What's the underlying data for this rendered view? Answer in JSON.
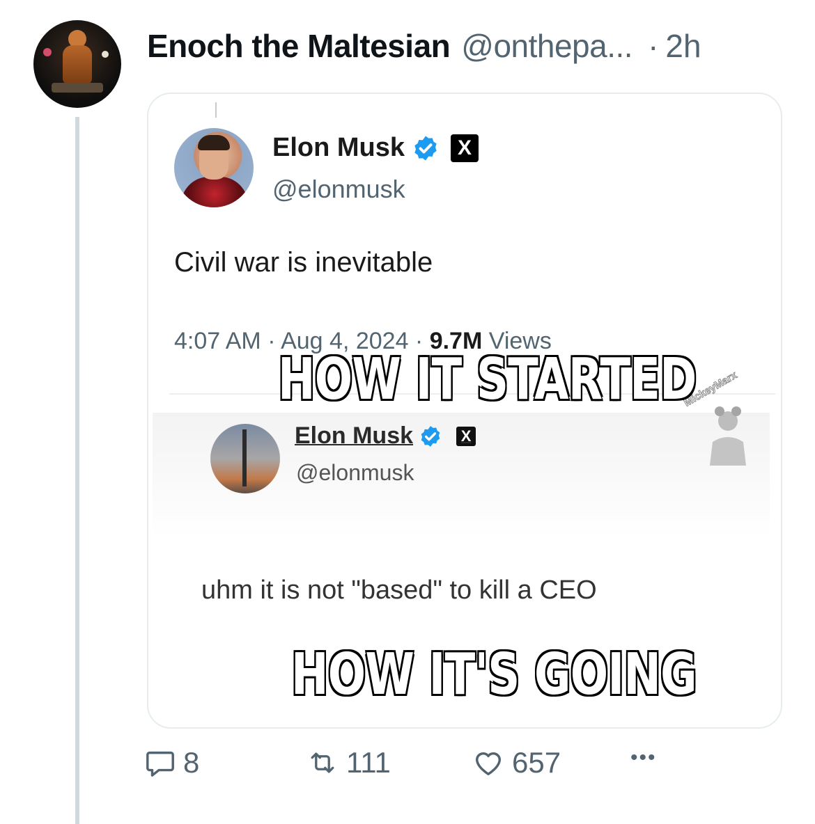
{
  "post": {
    "author_name": "Enoch the Maltesian",
    "author_handle": "@onthepa...",
    "separator": "·",
    "time": "2h"
  },
  "quoted_meme": {
    "top_tweet": {
      "name": "Elon Musk",
      "handle": "@elonmusk",
      "x_badge": "X",
      "text": "Civil war is inevitable",
      "time": "4:07 AM",
      "date": "Aug 4, 2024",
      "views_count": "9.7M",
      "views_label": "Views"
    },
    "caption_top": "HOW IT STARTED",
    "bottom_tweet": {
      "name": "Elon Musk",
      "handle": "@elonmusk",
      "x_badge": "X",
      "text": "uhm it is not \"based\" to kill a CEO"
    },
    "watermark": "MickeyMarx",
    "caption_bottom": "HOW IT'S GOING"
  },
  "actions": {
    "replies": "8",
    "retweets": "111",
    "likes": "657",
    "more": "•••"
  },
  "icons": {
    "reply": "reply-icon",
    "retweet": "retweet-icon",
    "like": "heart-icon",
    "more": "more-icon",
    "verified": "verified-badge-icon"
  },
  "colors": {
    "secondary_text": "#536471",
    "verified_blue": "#1d9bf0",
    "thread_line": "#cfd9de"
  }
}
